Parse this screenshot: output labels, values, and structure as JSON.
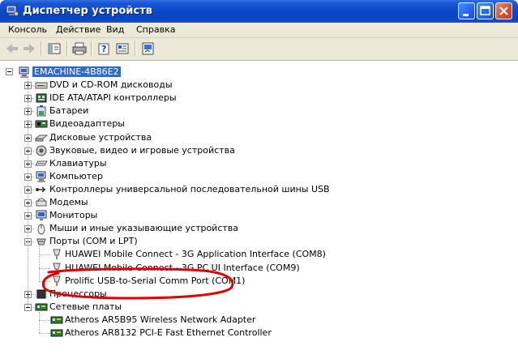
{
  "window": {
    "title": "Диспетчер устройств",
    "buttons": [
      "minimize-icon",
      "maximize-icon",
      "close-icon"
    ]
  },
  "menu": {
    "items": [
      "Консоль",
      "Действие",
      "Вид",
      "Справка"
    ]
  },
  "toolbar": {
    "icons": [
      "back-arrow-icon",
      "forward-arrow-icon",
      "show-hide-tree-icon",
      "print-icon",
      "help-icon",
      "properties-icon",
      "update-icon"
    ]
  },
  "tree": {
    "root": "EMACHINE-4B86E2",
    "categories": [
      {
        "label": "DVD и CD-ROM дисководы",
        "icon": "dvd-drive-icon",
        "expanded": false
      },
      {
        "label": "IDE ATA/ATAPI контроллеры",
        "icon": "ide-controller-icon",
        "expanded": false
      },
      {
        "label": "Батареи",
        "icon": "battery-icon",
        "expanded": false
      },
      {
        "label": "Видеоадаптеры",
        "icon": "display-adapter-icon",
        "expanded": false
      },
      {
        "label": "Дисковые устройства",
        "icon": "disk-drive-icon",
        "expanded": false
      },
      {
        "label": "Звуковые, видео и игровые устройства",
        "icon": "sound-icon",
        "expanded": false
      },
      {
        "label": "Клавиатуры",
        "icon": "keyboard-icon",
        "expanded": false
      },
      {
        "label": "Компьютер",
        "icon": "computer-icon",
        "expanded": false
      },
      {
        "label": "Контроллеры универсальной последовательной шины USB",
        "icon": "usb-icon",
        "expanded": false
      },
      {
        "label": "Модемы",
        "icon": "modem-icon",
        "expanded": false
      },
      {
        "label": "Мониторы",
        "icon": "monitor-icon",
        "expanded": false
      },
      {
        "label": "Мыши и иные указывающие устройства",
        "icon": "mouse-icon",
        "expanded": false
      },
      {
        "label": "Порты (COM и LPT)",
        "icon": "port-icon",
        "expanded": true,
        "children": [
          "HUAWEI Mobile Connect - 3G Application Interface (COM8)",
          "HUAWEI Mobile Connect - 3G PC UI Interface (COM9)",
          "Prolific USB-to-Serial Comm Port (COM1)"
        ]
      },
      {
        "label": "Процессоры",
        "icon": "processor-icon",
        "expanded": false
      },
      {
        "label": "Сетевые платы",
        "icon": "network-card-icon",
        "expanded": true,
        "children": [
          "Atheros AR5B95 Wireless Network Adapter",
          "Atheros AR8132 PCI-E Fast Ethernet Controller"
        ]
      }
    ]
  },
  "colors": {
    "titlebar": "#0a48c8",
    "selection": "#316ac5",
    "annotation": "#e00000",
    "chrome": "#ece9d8"
  }
}
